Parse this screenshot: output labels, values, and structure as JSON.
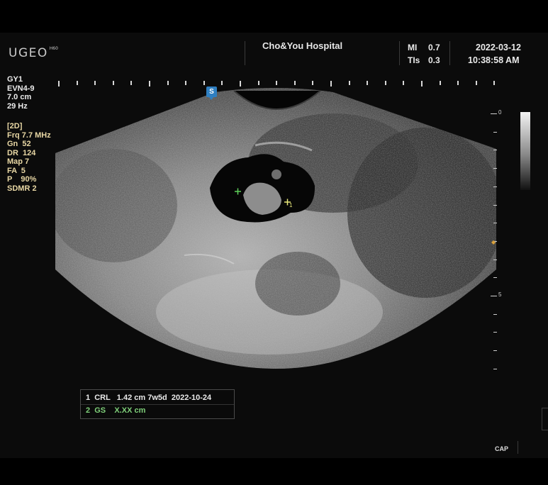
{
  "header": {
    "brand": "UGEO",
    "model": "H60",
    "hospital": "Cho&You Hospital",
    "mi_label": "MI",
    "mi_value": "0.7",
    "tis_label": "TIs",
    "tis_value": "0.3",
    "date": "2022-03-12",
    "time": "10:38:58 AM"
  },
  "probe": [
    "GY1",
    "EVN4-9",
    "7.0 cm",
    "29 Hz"
  ],
  "imaging_params": [
    "[2D]",
    "Frq 7.7 MHz",
    "Gn  52",
    "DR  124",
    "Map 7",
    "FA  5",
    "P    90%",
    "SDMR 2"
  ],
  "orientation_marker": "S",
  "depth_scale": {
    "labels": [
      "0",
      "5"
    ]
  },
  "calipers": {
    "label": "1"
  },
  "measurements": [
    {
      "text": "1  CRL   1.42 cm 7w5d  2022-10-24"
    },
    {
      "text": "2  GS    X.XX cm"
    }
  ],
  "footer": {
    "cap": "CAP"
  },
  "colors": {
    "caliper_start": "#5fd05a",
    "caliper_end": "#e8e87a",
    "params_text": "#e8d7a4",
    "marker": "#2f7fc1",
    "focus": "#d9a13b"
  }
}
